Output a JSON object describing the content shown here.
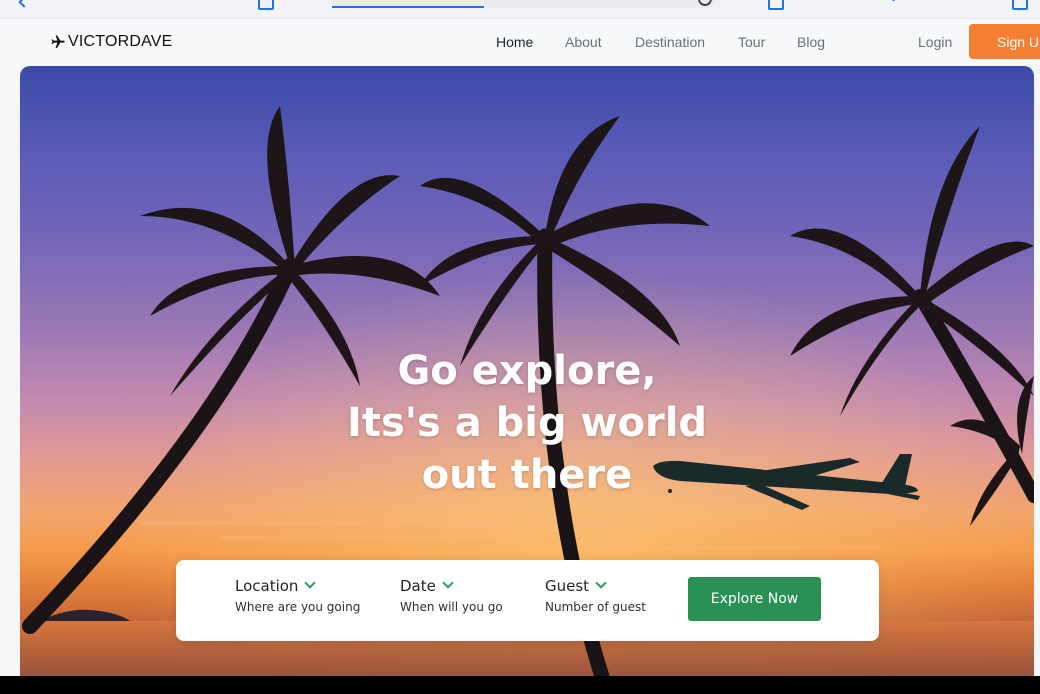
{
  "brand": {
    "name": "VICTORDAVE",
    "icon": "airplane-icon"
  },
  "nav": {
    "links": [
      {
        "label": "Home",
        "active": true
      },
      {
        "label": "About",
        "active": false
      },
      {
        "label": "Destination",
        "active": false
      },
      {
        "label": "Tour",
        "active": false
      },
      {
        "label": "Blog",
        "active": false
      }
    ],
    "login_label": "Login",
    "signup_label": "Sign Up"
  },
  "hero": {
    "title_lines": [
      "Go explore,",
      "Its's a big world",
      "out there"
    ]
  },
  "search": {
    "fields": [
      {
        "label": "Location",
        "sub": "Where are you going",
        "icon": "chevron-down-icon"
      },
      {
        "label": "Date",
        "sub": "When will you go",
        "icon": "chevron-down-icon"
      },
      {
        "label": "Guest",
        "sub": "Number of guest",
        "icon": "chevron-down-icon"
      }
    ],
    "explore_label": "Explore Now"
  },
  "colors": {
    "accent_orange": "#f47e32",
    "accent_green": "#2a9154",
    "chevron_green": "#2a9a5a"
  }
}
